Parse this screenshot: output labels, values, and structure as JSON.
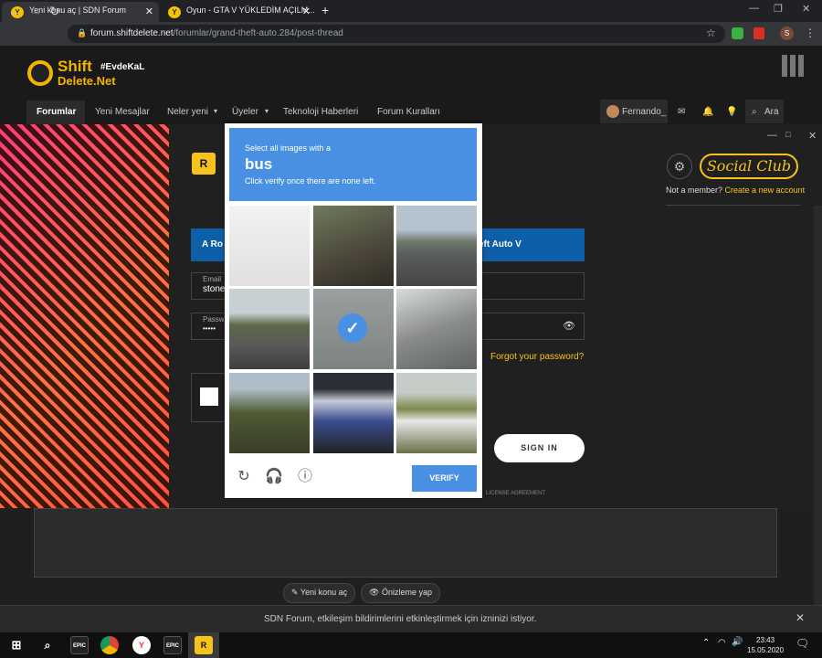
{
  "browser": {
    "tabs": [
      {
        "label": "Yeni konu aç | SDN Forum"
      },
      {
        "label": "Oyun - GTA V YÜKLEDİM AÇILM..."
      }
    ],
    "new_tab": "+",
    "url_host": "forum.shiftdelete.net",
    "url_path": "/forumlar/grand-theft-auto.284/post-thread",
    "profile_initial": "S"
  },
  "forum": {
    "logo_line1": "Shift",
    "logo_tag": "#EvdeKaL",
    "logo_line2": "Delete.Net",
    "nav": [
      "Forumlar",
      "Yeni Mesajlar",
      "Neler yeni",
      "Üyeler",
      "Teknoloji Haberleri",
      "Forum Kuralları"
    ],
    "user": "Fernando_",
    "search_label": "Ara",
    "new_thread": "Yeni konu aç",
    "preview": "Önizleme yap",
    "notification": "SDN Forum, etkileşim bildirimlerini etkinleştirmek için izninizi istiyor."
  },
  "rockstar": {
    "logo": "R",
    "socialclub": "Social Club",
    "not_member": "Not a member?",
    "create_account": "Create a new account",
    "banner_left": "A Ro",
    "banner_right": "eft Auto V",
    "email_label": "Email",
    "email_value": "stone",
    "password_label": "Passw",
    "password_value": "•••••",
    "forgot": "Forgot your password?",
    "signin": "SIGN IN",
    "license": "LICENSE AGREEMENT"
  },
  "captcha": {
    "line1": "Select all images with a",
    "keyword": "bus",
    "line3": "Click verify once there are none left.",
    "verify": "VERIFY",
    "tiles": [
      {
        "selected": false
      },
      {
        "selected": false
      },
      {
        "selected": false
      },
      {
        "selected": false
      },
      {
        "selected": true
      },
      {
        "selected": false
      },
      {
        "selected": false
      },
      {
        "selected": false
      },
      {
        "selected": false
      }
    ],
    "accent": "#4a90e2"
  },
  "taskbar": {
    "time": "23:43",
    "date": "15.05.2020"
  }
}
